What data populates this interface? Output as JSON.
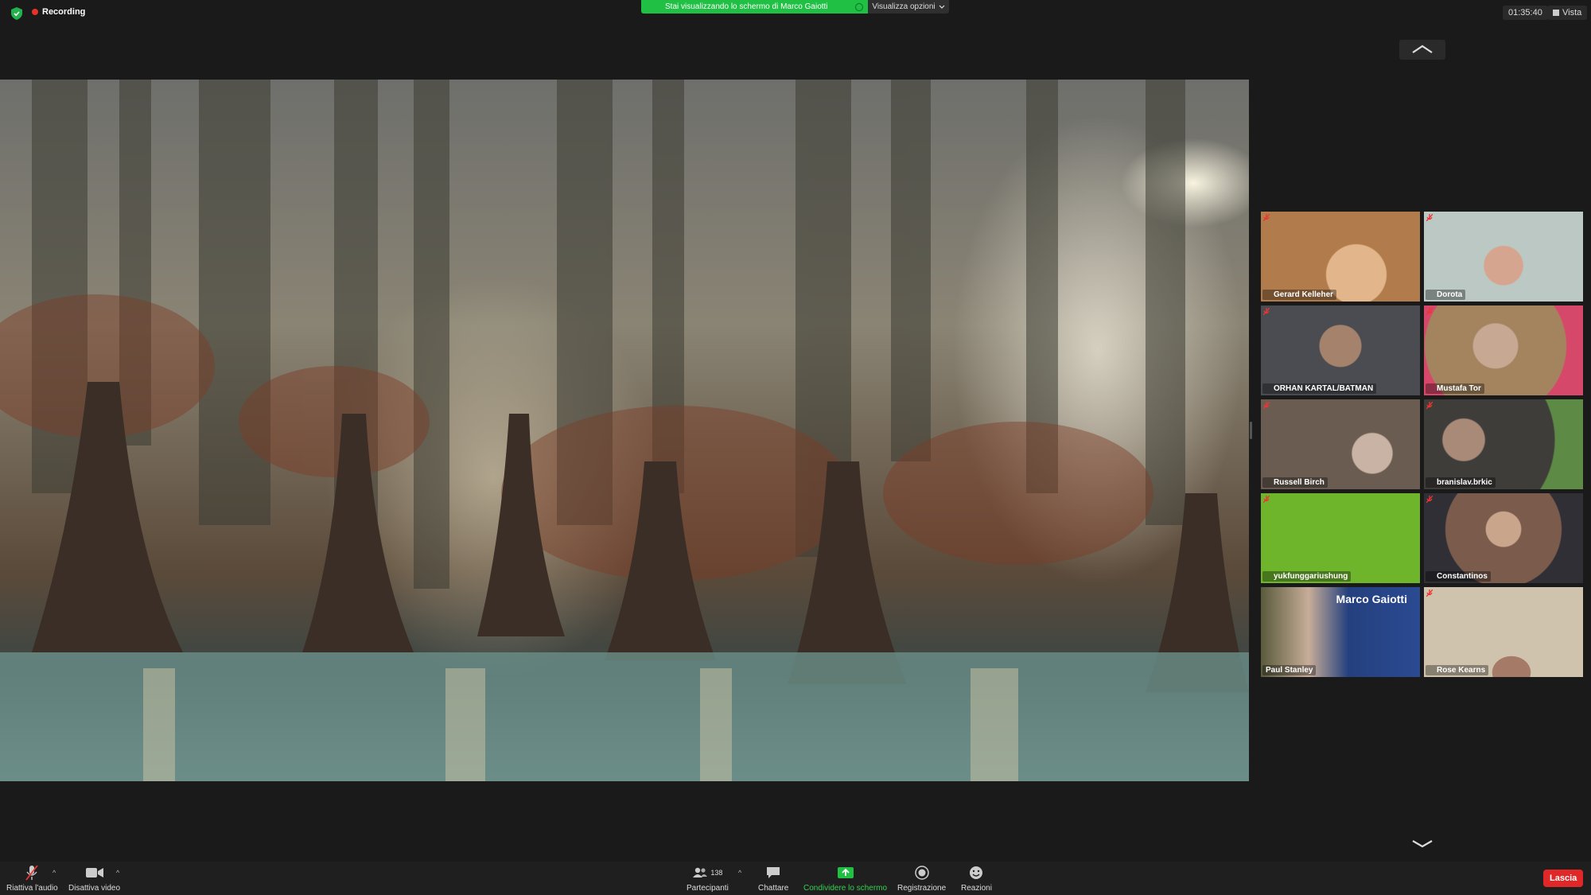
{
  "topbar": {
    "recording_label": "Recording",
    "share_banner_text": "Stai visualizzando lo schermo di Marco Gaiotti",
    "view_options_label": "Visualizza opzioni",
    "timer": "01:35:40",
    "view_label": "Vista"
  },
  "participants_gallery": [
    {
      "name": "Gerard Kelleher",
      "muted": true,
      "bg": "#c9955f"
    },
    {
      "name": "Dorota",
      "muted": true,
      "bg": "#b9c6c1"
    },
    {
      "name": "ORHAN KARTAL/BATMAN",
      "muted": true,
      "bg": "#3a3c40"
    },
    {
      "name": "Mustafa Tor",
      "muted": true,
      "bg": "#a88662"
    },
    {
      "name": "Russell Birch",
      "muted": true,
      "bg": "#6b5c52"
    },
    {
      "name": "branislav.brkic",
      "muted": true,
      "bg": "#4f4d47"
    },
    {
      "name": "yukfunggariushung",
      "muted": true,
      "bg": "#6fb52c"
    },
    {
      "name": "Constantinos",
      "muted": true,
      "bg": "#7a5b4c"
    },
    {
      "name": "Paul Stanley",
      "muted": false,
      "bg": "#24407e",
      "overlay_text": "Marco Gaiotti"
    },
    {
      "name": "Rose Kearns",
      "muted": true,
      "bg": "#cfc3ad"
    }
  ],
  "toolbar": {
    "unmute_label": "Riattiva l'audio",
    "stop_video_label": "Disattiva video",
    "participants_label": "Partecipanti",
    "participants_count": "138",
    "chat_label": "Chattare",
    "share_label": "Condividere lo schermo",
    "record_label": "Registrazione",
    "reactions_label": "Reazioni",
    "leave_label": "Lascia"
  },
  "colors": {
    "share_green": "#20c044",
    "leave_red": "#e02828",
    "recording_red": "#e5332a",
    "background": "#1a1a1a"
  }
}
